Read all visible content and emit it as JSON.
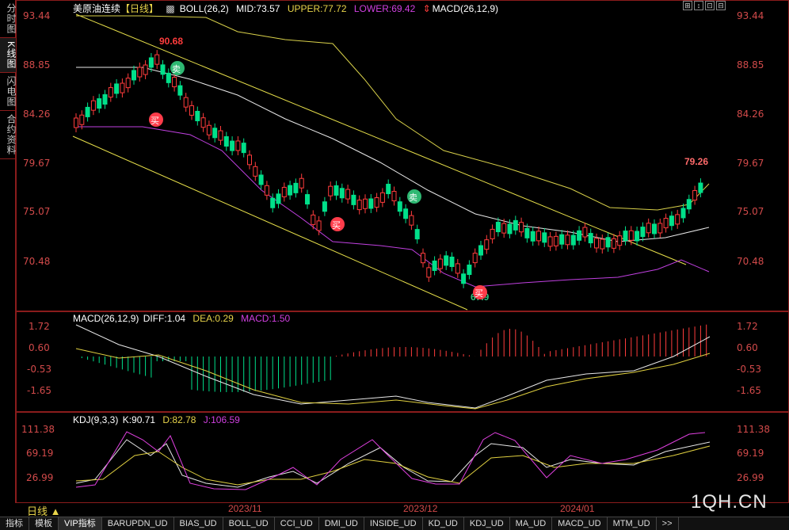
{
  "left_tabs": [
    "分时图",
    "K线图",
    "闪电图",
    "合约资料"
  ],
  "main_title": {
    "symbol": "美原油连续",
    "period": "【日线】",
    "boll": "BOLL(26,2)",
    "mid": "MID:73.57",
    "upper": "UPPER:77.72",
    "lower": "LOWER:69.42",
    "macd": "MACD(26,12,9)"
  },
  "main_axis": [
    "93.44",
    "88.85",
    "84.26",
    "79.67",
    "75.07",
    "70.48"
  ],
  "annotations": {
    "high": "90.68",
    "last": "79.26",
    "low_partial": "67.9",
    "buy": "买",
    "sell": "卖"
  },
  "macd_title": {
    "name": "MACD(26,12,9)",
    "diff": "DIFF:1.04",
    "dea": "DEA:0.29",
    "macd": "MACD:1.50"
  },
  "macd_axis": [
    "1.72",
    "0.60",
    "-0.53",
    "-1.65"
  ],
  "kdj_title": {
    "name": "KDJ(9,3,3)",
    "k": "K:90.71",
    "d": "D:82.78",
    "j": "J:106.59"
  },
  "kdj_axis": [
    "111.38",
    "69.19",
    "26.99"
  ],
  "period_label": "日线 ▲",
  "dates": [
    "2023/11",
    "2023/12",
    "2024/01"
  ],
  "watermark": "1QH.CN",
  "bottom_tabs": [
    "指标",
    "模板",
    "VIP指标",
    "BARUPDN_UD",
    "BIAS_UD",
    "BOLL_UD",
    "CCI_UD",
    "DMI_UD",
    "INSIDE_UD",
    "KD_UD",
    "KDJ_UD",
    "MA_UD",
    "MACD_UD",
    "MTM_UD",
    ">>"
  ],
  "window_buttons": [
    "⊞",
    "↕",
    "⊡",
    "⊟"
  ],
  "colors": {
    "up": "#ff3c3c",
    "down": "#00e08a",
    "frame": "#8a1c1c",
    "axis": "#d24a4a",
    "upper": "#d8d04a",
    "mid": "#e8e8e8",
    "lower": "#c040e0",
    "diff": "#e8e8e8",
    "dea": "#e0d040",
    "k": "#e8e8e8",
    "d": "#e0d040",
    "j": "#e040e0"
  },
  "chart_data": {
    "type": "candlestick",
    "price_axis": [
      70.48,
      75.07,
      79.67,
      84.26,
      88.85,
      93.44
    ],
    "dates": [
      "2023/11",
      "2023/12",
      "2024/01"
    ],
    "series": [
      {
        "name": "BOLL(26,2)"
      },
      {
        "name": "MACD(26,12,9)"
      },
      {
        "name": "KDJ(9,3,3)"
      }
    ]
  }
}
